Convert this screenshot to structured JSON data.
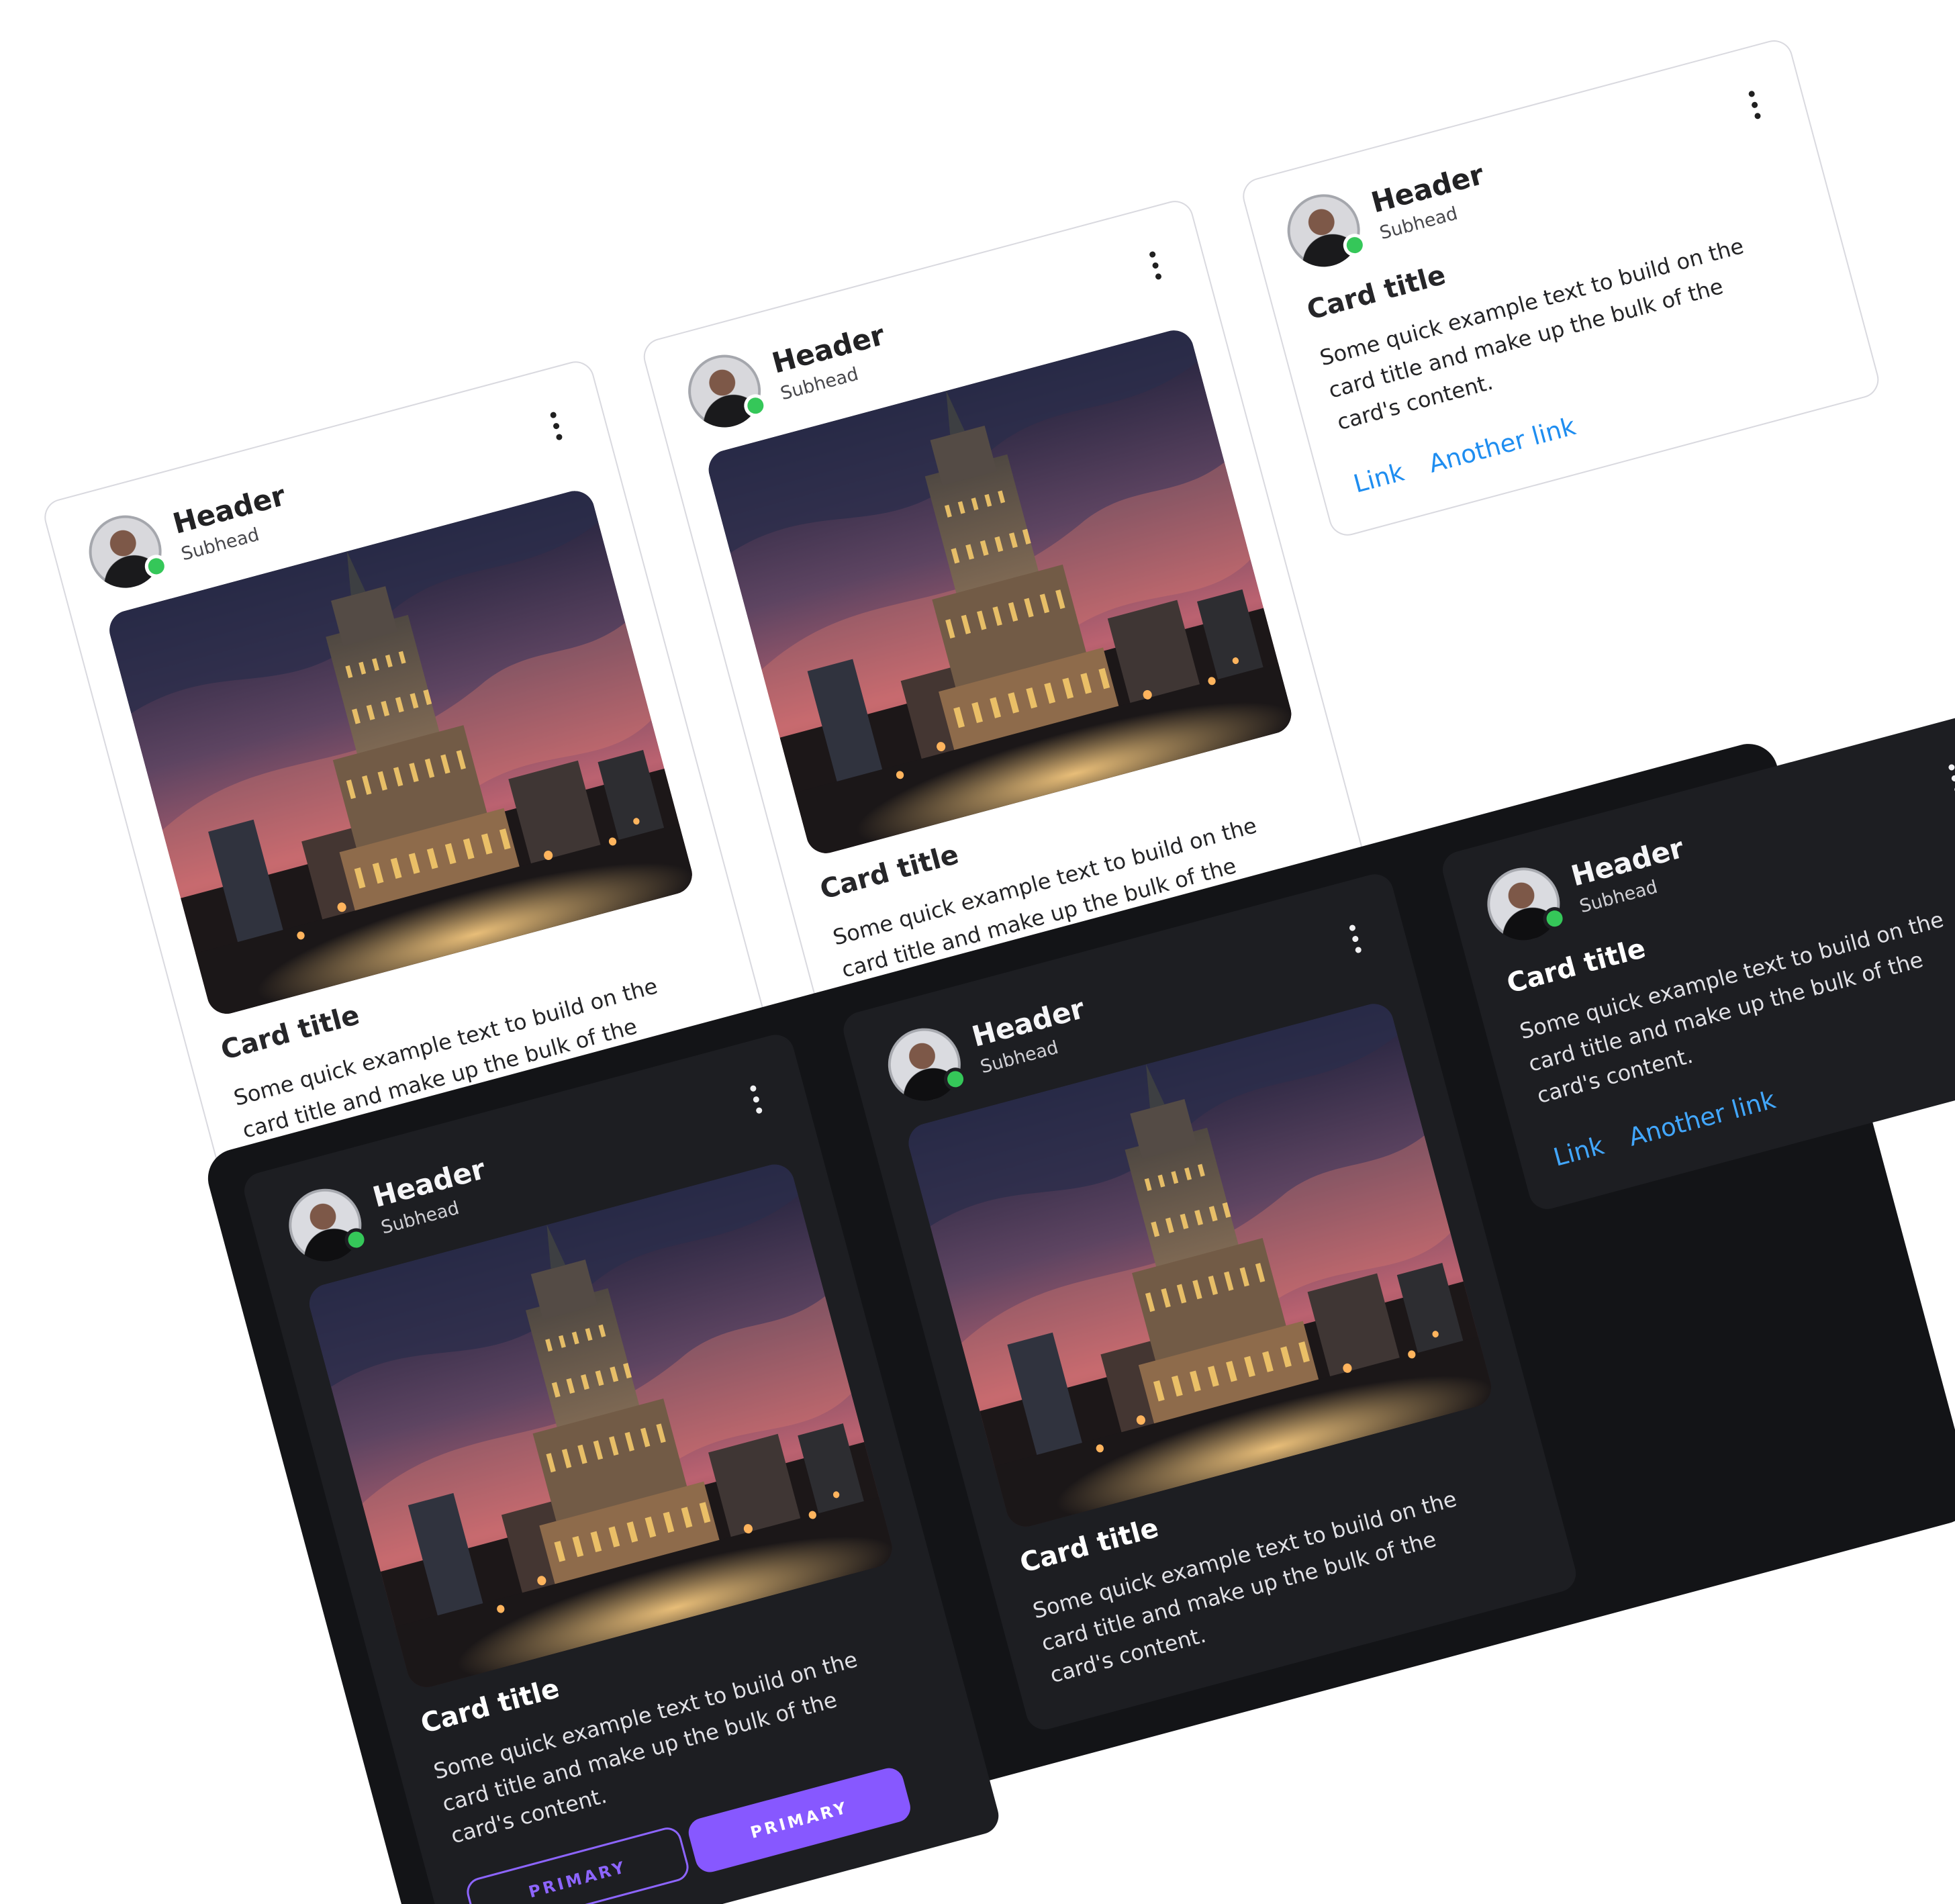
{
  "cards": {
    "header": "Header",
    "subhead": "Subhead",
    "title": "Card title",
    "text": "Some quick example text to build on the card title and make up the bulk of the card's content.",
    "button_outline": "PRIMARY",
    "button_solid": "PRIMARY",
    "link_1": "Link",
    "link_2": "Another link"
  },
  "colors": {
    "primary_light": "#6c2cf8",
    "primary_dark": "#8758ff",
    "link": "#1e8df0",
    "status": "#35c759",
    "dark_bg": "#131417",
    "dark_card": "#1d1e22"
  },
  "icons": {
    "menu": "vertical-ellipsis-icon",
    "status": "online-status-icon",
    "avatar": "avatar-icon"
  }
}
